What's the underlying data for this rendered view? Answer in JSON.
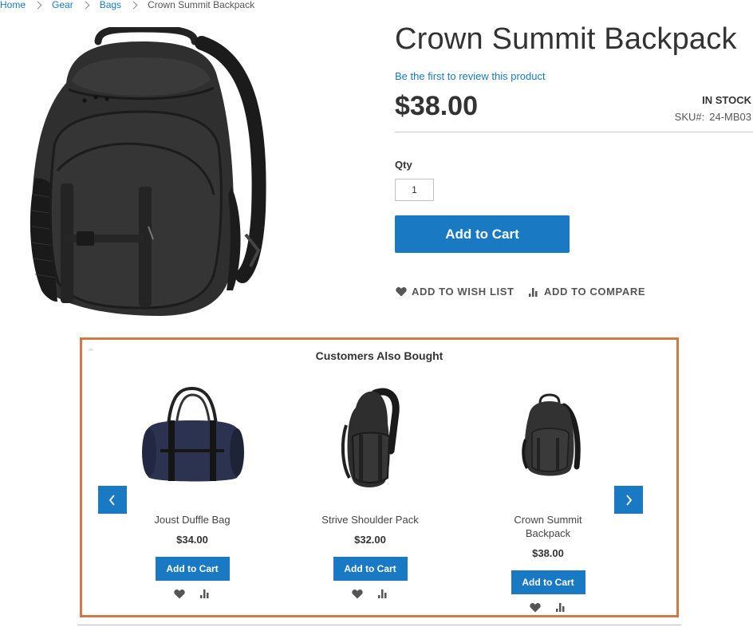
{
  "breadcrumb": {
    "items": [
      "Home",
      "Gear",
      "Bags",
      "Crown Summit Backpack"
    ]
  },
  "product": {
    "title": "Crown Summit Backpack",
    "review_link": "Be the first to review this product",
    "price": "$38.00",
    "stock": "IN STOCK",
    "sku_label": "SKU#:",
    "sku_value": "24-MB03",
    "qty_label": "Qty",
    "qty_value": "1",
    "add_to_cart": "Add to Cart",
    "wishlist": "ADD TO WISH LIST",
    "compare": "ADD TO COMPARE"
  },
  "related": {
    "title": "Customers Also Bought",
    "items": [
      {
        "name": "Joust Duffle Bag",
        "price": "$34.00",
        "button": "Add to Cart"
      },
      {
        "name": "Strive Shoulder Pack",
        "price": "$32.00",
        "button": "Add to Cart"
      },
      {
        "name": "Crown Summit Backpack",
        "price": "$38.00",
        "button": "Add to Cart"
      }
    ]
  },
  "colors": {
    "accent": "#1979c3",
    "highlight_border": "#d07a4a",
    "text": "#333333"
  },
  "icons": [
    "chevron-right-icon",
    "heart-icon",
    "compare-icon",
    "chevron-left-icon"
  ]
}
